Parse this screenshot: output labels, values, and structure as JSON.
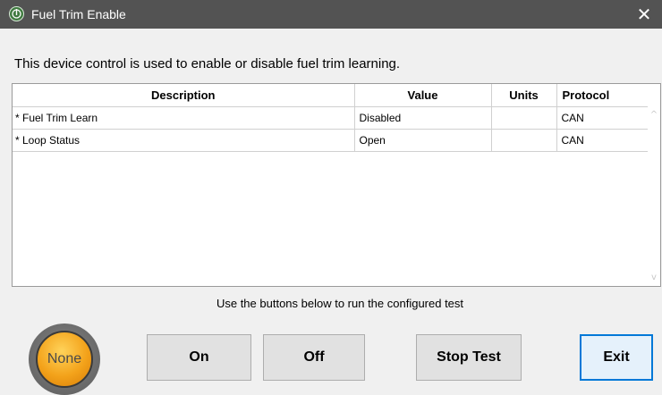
{
  "window": {
    "title": "Fuel Trim Enable",
    "close_glyph": "✕",
    "icon": "app-logo-icon"
  },
  "description": "This device control is used to enable or disable fuel trim learning.",
  "table": {
    "headers": {
      "description": "Description",
      "value": "Value",
      "units": "Units",
      "protocol": "Protocol"
    },
    "rows": [
      {
        "description": "* Fuel Trim Learn",
        "value": "Disabled",
        "units": "",
        "protocol": "CAN"
      },
      {
        "description": "* Loop Status",
        "value": "Open",
        "units": "",
        "protocol": "CAN"
      }
    ]
  },
  "scroll": {
    "up_glyph": "^",
    "down_glyph": "v"
  },
  "hint": "Use the buttons below to run the configured test",
  "status_lamp": {
    "label": "None",
    "color": "#f3a21a"
  },
  "buttons": {
    "on": "On",
    "off": "Off",
    "stop_test": "Stop Test",
    "exit": "Exit"
  },
  "colors": {
    "titlebar": "#535353",
    "accent": "#0078d7"
  }
}
